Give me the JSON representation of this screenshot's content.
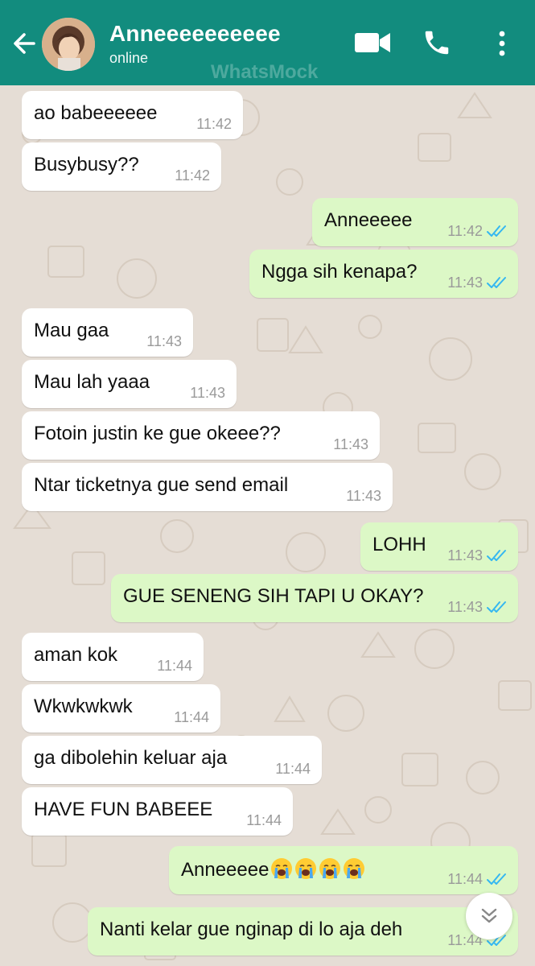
{
  "header": {
    "contact_name": "Anneeeeeeeeee",
    "status": "online",
    "watermark": "WhatsMock",
    "background_color": "#128c7e",
    "icons": [
      "back-arrow-icon",
      "video-call-icon",
      "phone-icon",
      "more-vert-icon"
    ]
  },
  "messages": [
    {
      "direction": "in",
      "text": "ao babeeeeee",
      "time": "11:42"
    },
    {
      "direction": "in",
      "text": "Busybusy??",
      "time": "11:42"
    },
    {
      "direction": "out",
      "text": "Anneeeee",
      "time": "11:42",
      "read": true
    },
    {
      "direction": "out",
      "text": "Ngga sih kenapa?",
      "time": "11:43",
      "read": true
    },
    {
      "direction": "in",
      "text": "Mau gaa",
      "time": "11:43"
    },
    {
      "direction": "in",
      "text": "Mau lah yaaa",
      "time": "11:43"
    },
    {
      "direction": "in",
      "text": "Fotoin justin ke gue okeee??",
      "time": "11:43"
    },
    {
      "direction": "in",
      "text": "Ntar ticketnya gue send email",
      "time": "11:43"
    },
    {
      "direction": "out",
      "text": "LOHH",
      "time": "11:43",
      "read": true
    },
    {
      "direction": "out",
      "text": "GUE SENENG SIH TAPI U OKAY?",
      "time": "11:43",
      "read": true
    },
    {
      "direction": "in",
      "text": "aman kok",
      "time": "11:44"
    },
    {
      "direction": "in",
      "text": "Wkwkwkwk",
      "time": "11:44"
    },
    {
      "direction": "in",
      "text": "ga dibolehin keluar aja",
      "time": "11:44"
    },
    {
      "direction": "in",
      "text": "HAVE FUN BABEEE",
      "time": "11:44"
    },
    {
      "direction": "out",
      "text": "Anneeeee",
      "emoji": [
        "loudly-crying-face",
        "loudly-crying-face",
        "loudly-crying-face",
        "loudly-crying-face"
      ],
      "time": "11:44",
      "read": true
    },
    {
      "direction": "out",
      "text": "Nanti kelar gue nginap di lo aja deh",
      "time": "11:44",
      "read": true
    }
  ],
  "colors": {
    "incoming_bubble": "#ffffff",
    "outgoing_bubble": "#dcf8c6",
    "read_ticks": "#34b7f1",
    "chat_background": "#e5ddd5"
  },
  "scroll_button_icon": "double-chevron-down-icon"
}
